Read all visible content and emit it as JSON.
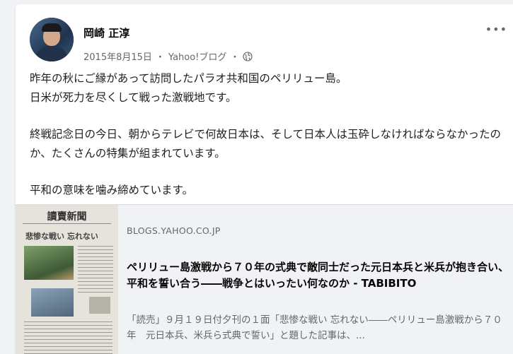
{
  "post": {
    "author": "岡崎 正淳",
    "date": "2015年8月15日",
    "separator": "・",
    "source": "Yahoo!ブログ",
    "separator2": "・",
    "privacy_icon": "globe-icon",
    "more_label": "•••",
    "paragraphs": [
      "昨年の秋にご縁があって訪問したパラオ共和国のペリリュー島。\n日米が死力を尽くして戦った激戦地です。",
      "終戦記念日の今日、朝からテレビで何故日本は、そして日本人は玉砕しなければならなかったのか、たくさんの特集が組まれています。",
      "平和の意味を噛み締めています。"
    ]
  },
  "link_preview": {
    "domain": "BLOGS.YAHOO.CO.JP",
    "title": "ペリリュー島激戦から７０年の式典で敵同士だった元日本兵と米兵が抱き合い、平和を誓い合う――戦争とはいったい何なのか - TABIBITO",
    "description": "「読売」９月１９日付夕刊の１面「悲惨な戦い 忘れない――ペリリュー島激戦から７０年　元日本兵、米兵ら式典で誓い」と題した記事は、...",
    "thumbnail": {
      "masthead": "讀賣新聞",
      "headline": "悲惨な戦い 忘れない"
    }
  }
}
